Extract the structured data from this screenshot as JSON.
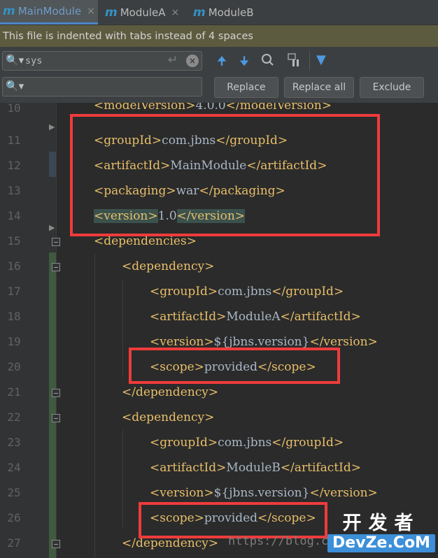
{
  "tabs": [
    {
      "icon": "m",
      "label": "MainModule",
      "active": true
    },
    {
      "icon": "m",
      "label": "ModuleA",
      "active": false
    },
    {
      "icon": "m",
      "label": "ModuleB",
      "active": false
    }
  ],
  "close_glyph": "×",
  "notice": "This file is indented with tabs instead of 4 spaces",
  "find": {
    "value": "sys",
    "enter_glyph": "↵",
    "clear_glyph": "×"
  },
  "replace": {
    "value": ""
  },
  "toolbar": {
    "prev_glyph": "🠉",
    "next_glyph": "🠋",
    "filter_glyph": "▼"
  },
  "buttons": {
    "replace": "Replace",
    "replace_all": "Replace all",
    "exclude": "Exclude"
  },
  "lines": [
    {
      "n": "10",
      "indent": 0,
      "text": [
        [
          "tag",
          "<modelVersion>"
        ],
        [
          "txt",
          "4.0.0"
        ],
        [
          "tag",
          "</modelVersion>"
        ]
      ]
    },
    {
      "n": "11",
      "indent": 0,
      "text": [
        [
          "tag",
          "<groupId>"
        ],
        [
          "txt",
          "com.jbns"
        ],
        [
          "tag",
          "</groupId>"
        ]
      ]
    },
    {
      "n": "12",
      "indent": 0,
      "text": [
        [
          "tag",
          "<artifactId>"
        ],
        [
          "txt",
          "MainModule"
        ],
        [
          "tag",
          "</artifactId>"
        ]
      ]
    },
    {
      "n": "13",
      "indent": 0,
      "text": [
        [
          "tag",
          "<packaging>"
        ],
        [
          "txt",
          "war"
        ],
        [
          "tag",
          "</packaging>"
        ]
      ]
    },
    {
      "n": "14",
      "indent": 0,
      "text": [
        [
          "hl",
          "<version>"
        ],
        [
          "txt",
          "1.0"
        ],
        [
          "hl",
          "</version>"
        ]
      ]
    },
    {
      "n": "15",
      "indent": 0,
      "text": [
        [
          "tag",
          "<dependencies>"
        ]
      ]
    },
    {
      "n": "16",
      "indent": 1,
      "text": [
        [
          "tag",
          "<dependency>"
        ]
      ]
    },
    {
      "n": "17",
      "indent": 2,
      "text": [
        [
          "tag",
          "<groupId>"
        ],
        [
          "txt",
          "com.jbns"
        ],
        [
          "tag",
          "</groupId>"
        ]
      ]
    },
    {
      "n": "18",
      "indent": 2,
      "text": [
        [
          "tag",
          "<artifactId>"
        ],
        [
          "txt",
          "ModuleA"
        ],
        [
          "tag",
          "</artifactId>"
        ]
      ]
    },
    {
      "n": "19",
      "indent": 2,
      "text": [
        [
          "tag",
          "<version>"
        ],
        [
          "txt",
          "${jbns.version}"
        ],
        [
          "tag",
          "</version>"
        ]
      ]
    },
    {
      "n": "20",
      "indent": 2,
      "text": [
        [
          "tag",
          "<scope>"
        ],
        [
          "txt",
          "provided"
        ],
        [
          "tag",
          "</scope>"
        ]
      ]
    },
    {
      "n": "21",
      "indent": 1,
      "text": [
        [
          "tag",
          "</dependency>"
        ]
      ]
    },
    {
      "n": "22",
      "indent": 1,
      "text": [
        [
          "tag",
          "<dependency>"
        ]
      ]
    },
    {
      "n": "23",
      "indent": 2,
      "text": [
        [
          "tag",
          "<groupId>"
        ],
        [
          "txt",
          "com.jbns"
        ],
        [
          "tag",
          "</groupId>"
        ]
      ]
    },
    {
      "n": "24",
      "indent": 2,
      "text": [
        [
          "tag",
          "<artifactId>"
        ],
        [
          "txt",
          "ModuleB"
        ],
        [
          "tag",
          "</artifactId>"
        ]
      ]
    },
    {
      "n": "25",
      "indent": 2,
      "text": [
        [
          "tag",
          "<version>"
        ],
        [
          "txt",
          "${jbns.version}"
        ],
        [
          "tag",
          "</version>"
        ]
      ]
    },
    {
      "n": "26",
      "indent": 2,
      "text": [
        [
          "tag",
          "<scope>"
        ],
        [
          "txt",
          "provided"
        ],
        [
          "tag",
          "</scope>"
        ]
      ]
    },
    {
      "n": "27",
      "indent": 1,
      "text": [
        [
          "tag",
          "</dependency>"
        ]
      ]
    }
  ],
  "overlay_url": "https://blog.cs",
  "watermark": {
    "cn": "开发者",
    "en": "DevZe.CoM"
  },
  "colors": {
    "annotation_red": "#ef3b3b",
    "tag": "#e8bf6a",
    "text": "#a9b7c6",
    "accent_blue": "#4a88c7"
  }
}
